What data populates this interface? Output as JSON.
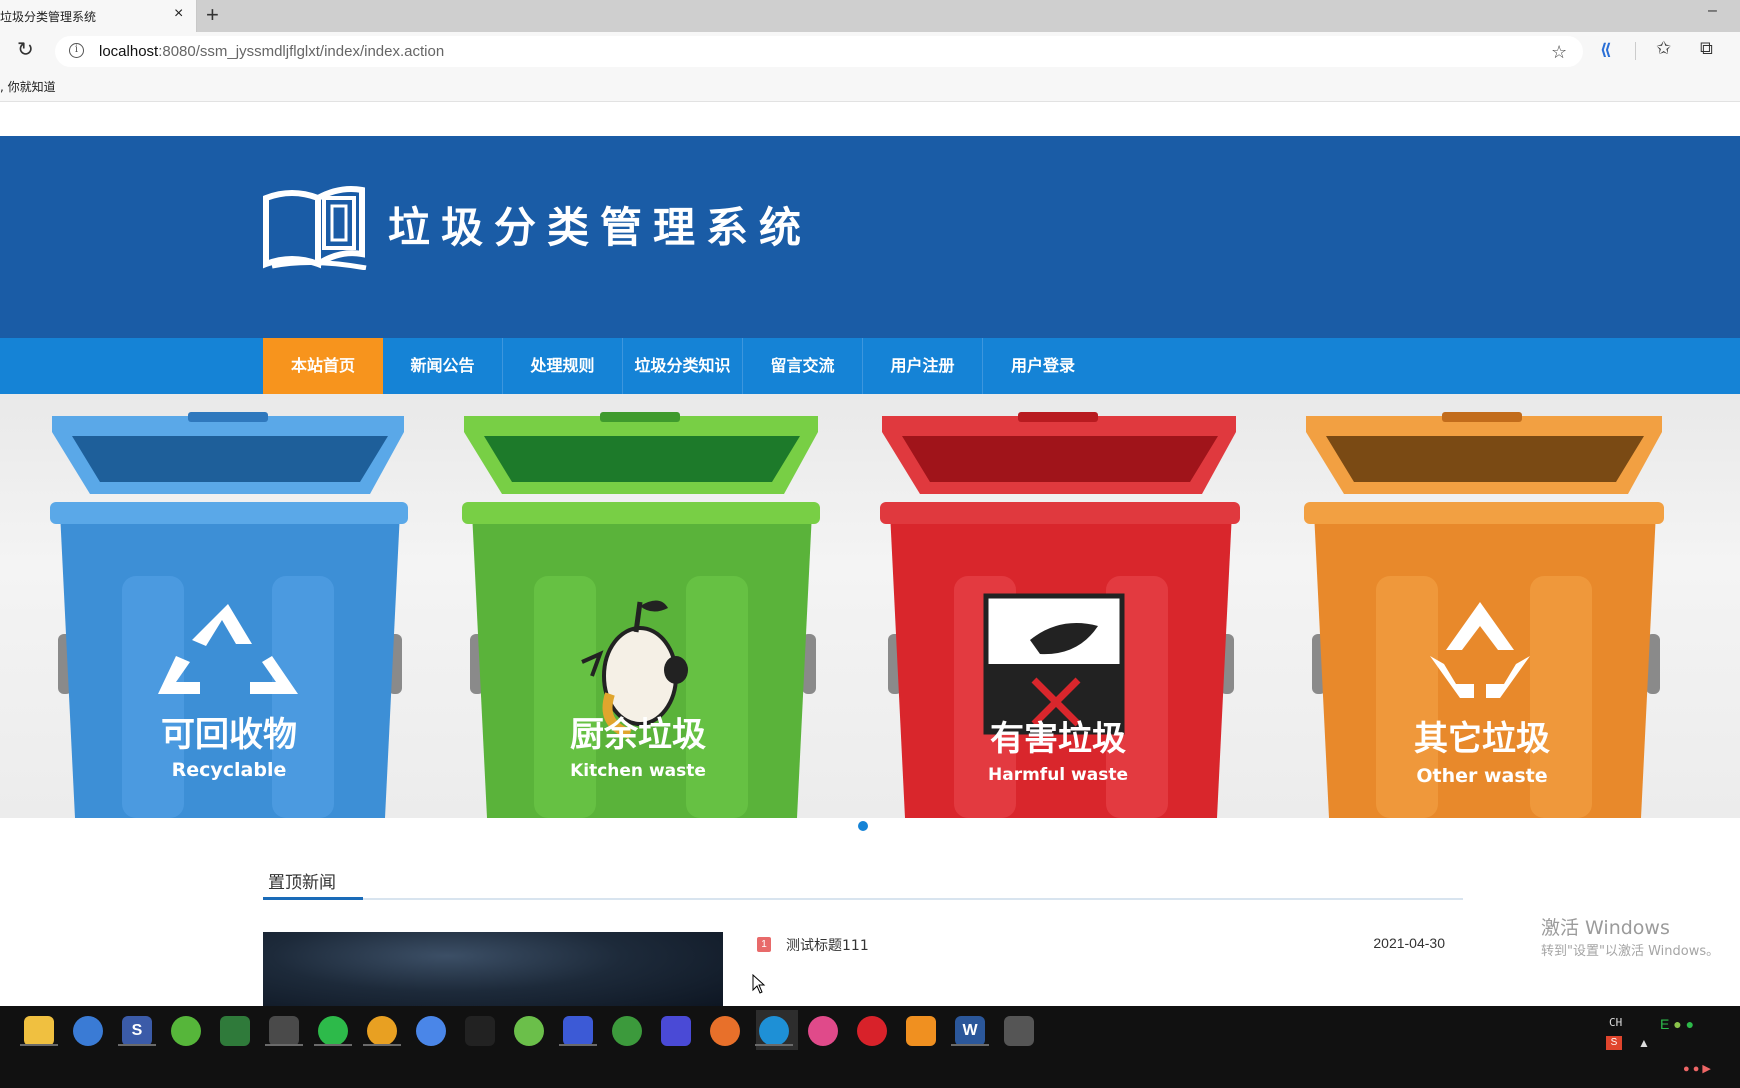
{
  "browser": {
    "tab_title": "垃圾分类管理系统",
    "tab_close": "×",
    "new_tab": "+",
    "minimize": "–",
    "url_host": "localhost",
    "url_path": ":8080/ssm_jyssmdljflglxt/index/index.action",
    "bookmark": ", 你就知道"
  },
  "site": {
    "title": "垃圾分类管理系统",
    "colors": {
      "header": "#1a5ca6",
      "nav": "#1583d6",
      "nav_active": "#f7941d"
    }
  },
  "nav": {
    "items": [
      {
        "label": "本站首页",
        "active": true
      },
      {
        "label": "新闻公告",
        "active": false
      },
      {
        "label": "处理规则",
        "active": false
      },
      {
        "label": "垃圾分类知识",
        "active": false
      },
      {
        "label": "留言交流",
        "active": false
      },
      {
        "label": "用户注册",
        "active": false
      },
      {
        "label": "用户登录",
        "active": false
      }
    ]
  },
  "banner": {
    "bins": [
      {
        "cn": "可回收物",
        "en": "Recyclable",
        "color": "#3d8fd6"
      },
      {
        "cn": "厨余垃圾",
        "en": "Kitchen waste",
        "color": "#5ab33a"
      },
      {
        "cn": "有害垃圾",
        "en": "Harmful waste",
        "color": "#d9262c"
      },
      {
        "cn": "其它垃圾",
        "en": "Other waste",
        "color": "#e8892b"
      }
    ]
  },
  "news": {
    "section_title": "置顶新闻",
    "items": [
      {
        "num": "1",
        "title": "测试标题111",
        "date": "2021-04-30"
      }
    ]
  },
  "watermark": {
    "title": "激活 Windows",
    "subtitle": "转到\"设置\"以激活 Windows。"
  },
  "taskbar": {
    "tray_lang": "CH"
  }
}
